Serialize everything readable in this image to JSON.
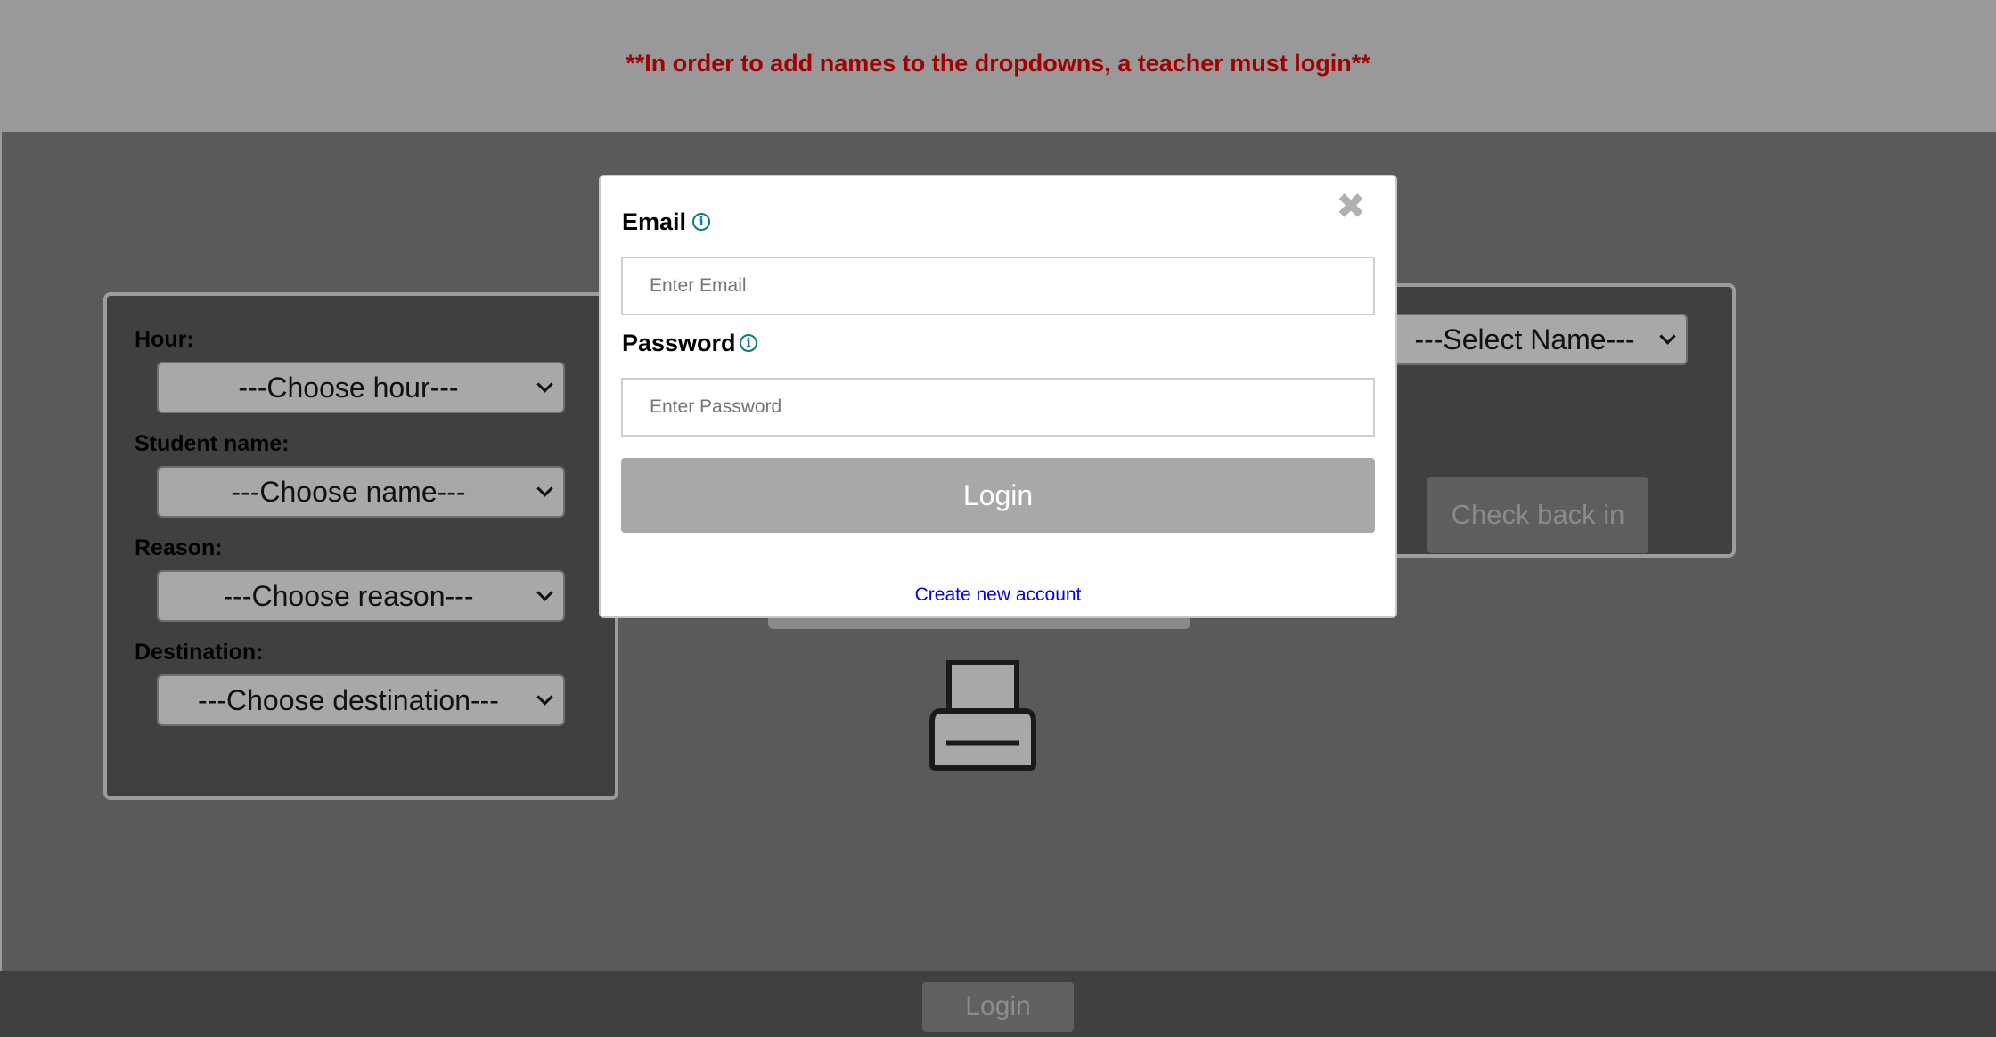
{
  "banner": {
    "notice": "**In order to add names to the dropdowns, a teacher must login**",
    "notice_color": "#a00000"
  },
  "form": {
    "hour_label": "Hour:",
    "hour_value": "---Choose hour---",
    "student_label": "Student name:",
    "student_value": "---Choose name---",
    "reason_label": "Reason:",
    "reason_value": "---Choose reason---",
    "destination_label": "Destination:",
    "destination_value": "---Choose destination---"
  },
  "checkin": {
    "select_value": "---Select Name---",
    "button_label": "Check back in"
  },
  "printer": {
    "icon": "printer-icon"
  },
  "modal": {
    "email_label": "Email",
    "email_placeholder": "Enter Email",
    "password_label": "Password",
    "password_placeholder": "Enter Password",
    "login_label": "Login",
    "create_account_label": "Create new account",
    "close_icon": "close-icon",
    "info_icon": "info-icon",
    "info_color": "#0b7a86"
  },
  "footer": {
    "login_label": "Login"
  }
}
